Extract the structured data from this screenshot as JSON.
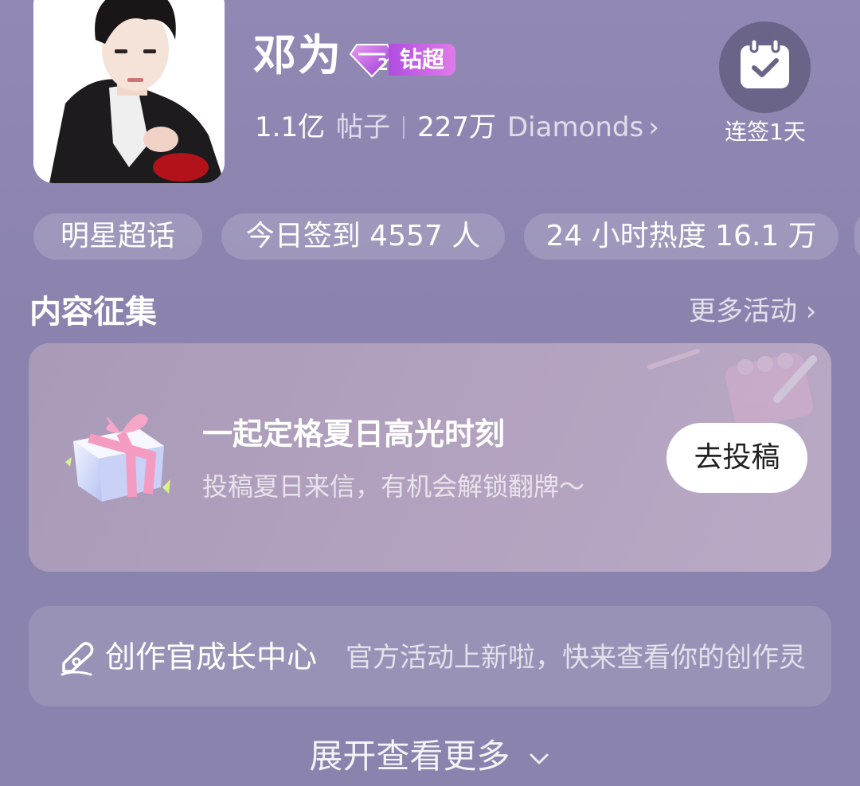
{
  "profile": {
    "name": "邓为",
    "badge_level": "2",
    "badge_label": "钻超",
    "posts_count": "1.1亿",
    "posts_label": "帖子",
    "diamonds_count": "227万",
    "diamonds_label": "Diamonds",
    "diamonds_chevron": "›"
  },
  "checkin": {
    "icon": "calendar-check-icon",
    "label": "连签1天"
  },
  "tags": [
    "明星超话",
    "今日签到 4557 人",
    "24 小时热度 16.1 万"
  ],
  "section": {
    "title": "内容征集",
    "more": "更多活动 ›"
  },
  "activity_card": {
    "icon": "gift-box-icon",
    "title": "一起定格夏日高光时刻",
    "subtitle": "投稿夏日来信，有机会解锁翻牌～",
    "button": "去投稿"
  },
  "creator_card": {
    "icon": "pen-icon",
    "title": "创作官成长中心",
    "text": "官方活动上新啦，快来查看你的创作灵"
  },
  "expand": {
    "label": "展开查看更多",
    "icon": "chevron-down-icon"
  },
  "colors": {
    "background": "#8f87b2",
    "badge": "#c25ee6",
    "checkin_bg": "#6a6488"
  }
}
